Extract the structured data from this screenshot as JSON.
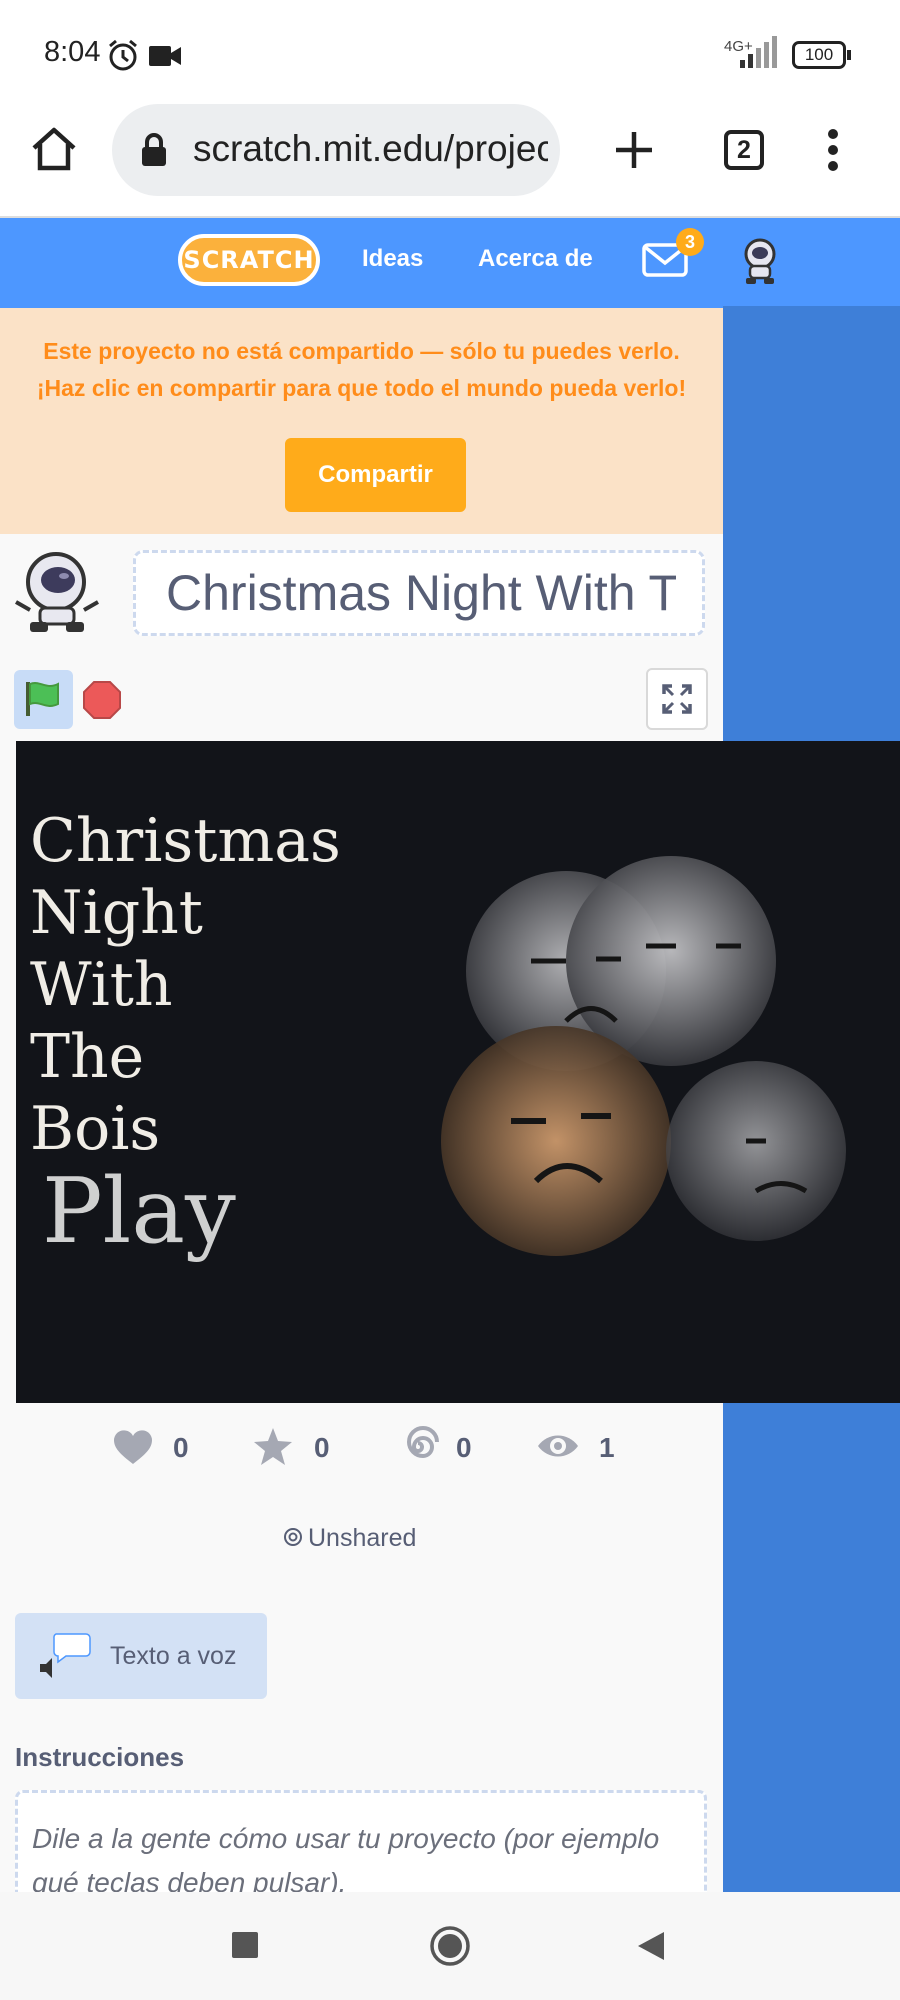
{
  "status_bar": {
    "time": "8:04",
    "network": "4G+",
    "battery": "100"
  },
  "browser": {
    "url": "scratch.mit.edu/projects/",
    "tab_count": "2"
  },
  "scratch_nav": {
    "logo": "SCRATCH",
    "ideas": "Ideas",
    "about": "Acerca de",
    "messages_count": "3"
  },
  "banner": {
    "line1": "Este proyecto no está compartido — sólo tu puedes verlo.",
    "line2": "¡Haz clic en compartir para que todo el mundo pueda verlo!",
    "share_button": "Compartir"
  },
  "project": {
    "title": "Christmas Night With The Bois",
    "stage_title": "Christmas\nNight\nWith\nThe\nBois",
    "stage_play": "Play",
    "stats": {
      "loves": "0",
      "favorites": "0",
      "remixes": "0",
      "views": "1"
    },
    "status": "Unshared"
  },
  "tts_button": "Texto a voz",
  "instructions": {
    "heading": "Instrucciones",
    "placeholder": "Dile a la gente cómo usar tu proyecto (por ejemplo qué teclas deben pulsar)."
  },
  "colors": {
    "scratch_blue": "#4d97ff",
    "accent_orange": "#ffab1a",
    "text": "#575e75"
  }
}
